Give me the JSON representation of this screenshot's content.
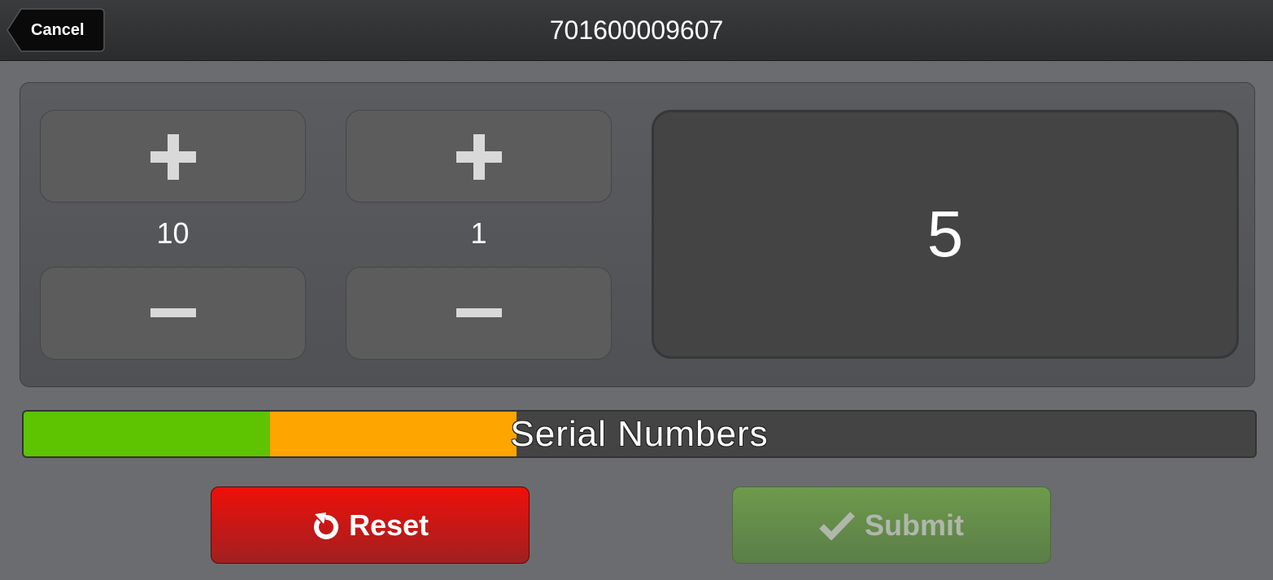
{
  "header": {
    "cancel_label": "Cancel",
    "title": "701600009607"
  },
  "counter": {
    "tens": {
      "label": "10",
      "increment_icon": "plus-icon",
      "decrement_icon": "minus-icon"
    },
    "ones": {
      "label": "1",
      "increment_icon": "plus-icon",
      "decrement_icon": "minus-icon"
    },
    "total": "5"
  },
  "progress": {
    "label": "Serial Numbers",
    "segments": [
      {
        "color": "#5ec300",
        "fraction": 0.2
      },
      {
        "color": "#ffa500",
        "fraction": 0.2
      }
    ]
  },
  "actions": {
    "reset_label": "Reset",
    "reset_icon": "undo-icon",
    "submit_label": "Submit",
    "submit_icon": "checkmark-icon"
  },
  "colors": {
    "header_bg": "#2b2c2e",
    "page_bg": "#6b6c70",
    "reset_red": "#ef0f0a",
    "submit_green": "#6e9a4c"
  }
}
